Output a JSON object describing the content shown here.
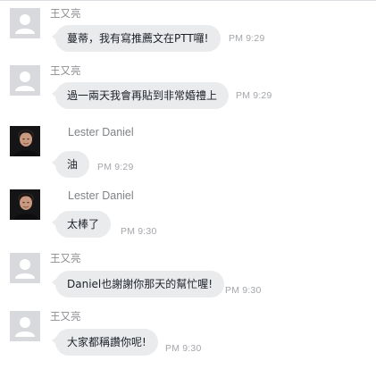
{
  "colors": {
    "bubble": "#eaebed",
    "name_text": "#8b8d91",
    "timestamp_text": "#a3a6aa",
    "message_text": "#1d2129",
    "default_avatar_bg": "#d7d9dc"
  },
  "messages": [
    {
      "sender": "王又亮",
      "avatar": "default-avatar-icon",
      "text": "蔓蒂，我有寫推薦文在PTT囉!",
      "time": "PM 9:29"
    },
    {
      "sender": "王又亮",
      "avatar": "default-avatar-icon",
      "text": "過一兩天我會再貼到非常婚禮上",
      "time": "PM 9:29"
    },
    {
      "sender": "Lester Daniel",
      "avatar": "profile-photo",
      "text": "油",
      "time": "PM 9:29"
    },
    {
      "sender": "Lester Daniel",
      "avatar": "profile-photo",
      "text": "太棒了",
      "time": "PM 9:30"
    },
    {
      "sender": "王又亮",
      "avatar": "default-avatar-icon",
      "text": "Daniel也謝謝你那天的幫忙喔!",
      "time": "PM 9:30"
    },
    {
      "sender": "王又亮",
      "avatar": "default-avatar-icon",
      "text": "大家都稱讚你呢!",
      "time": "PM 9:30"
    }
  ]
}
